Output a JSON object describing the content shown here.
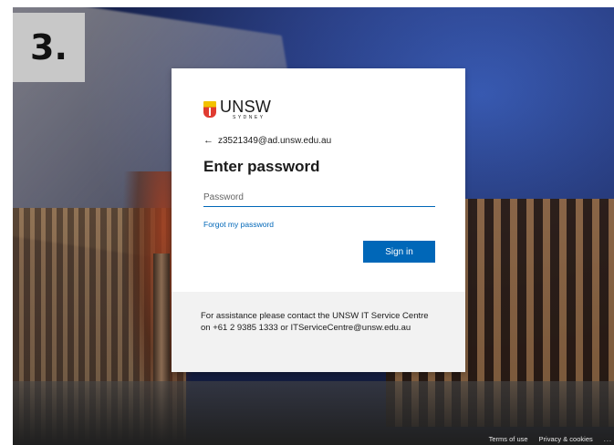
{
  "step": {
    "label": "3."
  },
  "brand": {
    "name": "UNSW",
    "sub": "SYDNEY"
  },
  "account": {
    "back_icon": "←",
    "email": "z3521349@ad.unsw.edu.au"
  },
  "form": {
    "title": "Enter password",
    "password_placeholder": "Password",
    "forgot_link": "Forgot my password",
    "signin_label": "Sign in"
  },
  "assistance": {
    "text": "For assistance please contact the UNSW IT Service Centre on +61 2 9385 1333 or ITServiceCentre@unsw.edu.au"
  },
  "footer": {
    "terms": "Terms of use",
    "privacy": "Privacy & cookies",
    "more": "..."
  },
  "colors": {
    "accent": "#0067b8",
    "badge": "#c8c8c8"
  }
}
